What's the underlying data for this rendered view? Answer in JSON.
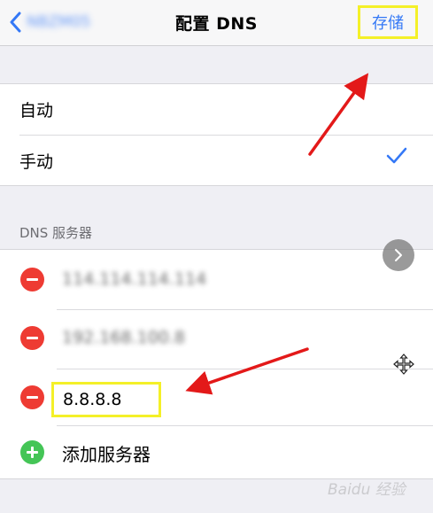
{
  "navbar": {
    "back_label": "NBZM05",
    "title": "配置 DNS",
    "save_label": "存储"
  },
  "mode": {
    "options": [
      {
        "label": "自动"
      },
      {
        "label": "手动"
      }
    ],
    "selected": "手动"
  },
  "servers": {
    "header": "DNS 服务器",
    "items": [
      {
        "value": "114.114.114.114"
      },
      {
        "value": "192.168.100.8"
      },
      {
        "value": "8.8.8.8"
      }
    ],
    "add_label": "添加服务器"
  },
  "watermark": "Baidu 经验",
  "colors": {
    "accent": "#3478f6",
    "delete": "#ee3b33",
    "add": "#44c556",
    "highlight_box": "#f4f028",
    "annotation_arrow": "#e31919"
  }
}
